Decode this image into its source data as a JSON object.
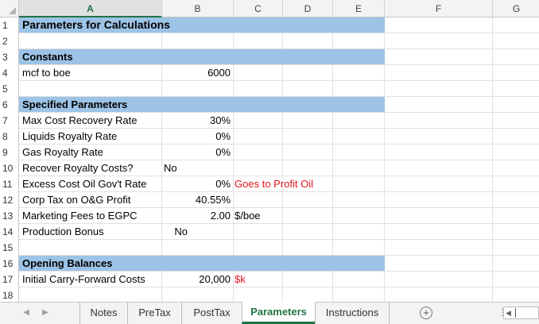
{
  "columns": [
    "A",
    "B",
    "C",
    "D",
    "E",
    "F",
    "G"
  ],
  "rows": [
    {
      "n": "1",
      "band": true,
      "label": "Parameters for Calculations",
      "big": true
    },
    {
      "n": "2"
    },
    {
      "n": "3",
      "band": true,
      "label": "Constants"
    },
    {
      "n": "4",
      "label": "mcf to boe",
      "b": "6000"
    },
    {
      "n": "5"
    },
    {
      "n": "6",
      "band": true,
      "label": "Specified Parameters"
    },
    {
      "n": "7",
      "label": "Max Cost Recovery Rate",
      "b": "30%"
    },
    {
      "n": "8",
      "label": "Liquids Royalty Rate",
      "b": "0%"
    },
    {
      "n": "9",
      "label": "Gas Royalty Rate",
      "b": "0%"
    },
    {
      "n": "10",
      "label": "Recover Royalty Costs?",
      "b_left": "No"
    },
    {
      "n": "11",
      "label": "Excess Cost Oil Gov't Rate",
      "b": "0%",
      "c": "Goes to Profit Oil",
      "c_red": true
    },
    {
      "n": "12",
      "label": "Corp Tax on O&G Profit",
      "b": "40.55%"
    },
    {
      "n": "13",
      "label": "Marketing Fees to EGPC",
      "b": "2.00",
      "c": "$/boe"
    },
    {
      "n": "14",
      "label": "Production Bonus",
      "b_center": "No"
    },
    {
      "n": "15"
    },
    {
      "n": "16",
      "band": true,
      "label": "Opening Balances"
    },
    {
      "n": "17",
      "label": "Initial Carry-Forward Costs",
      "b": "20,000",
      "c": "$k",
      "c_red": true
    },
    {
      "n": "18"
    }
  ],
  "tabs": [
    "Notes",
    "PreTax",
    "PostTax",
    "Parameters",
    "Instructions"
  ],
  "active_tab": "Parameters",
  "icons": {
    "add_sheet": "plus-circle-icon",
    "nav_prev": "chevron-left-icon",
    "nav_next": "chevron-right-icon"
  }
}
